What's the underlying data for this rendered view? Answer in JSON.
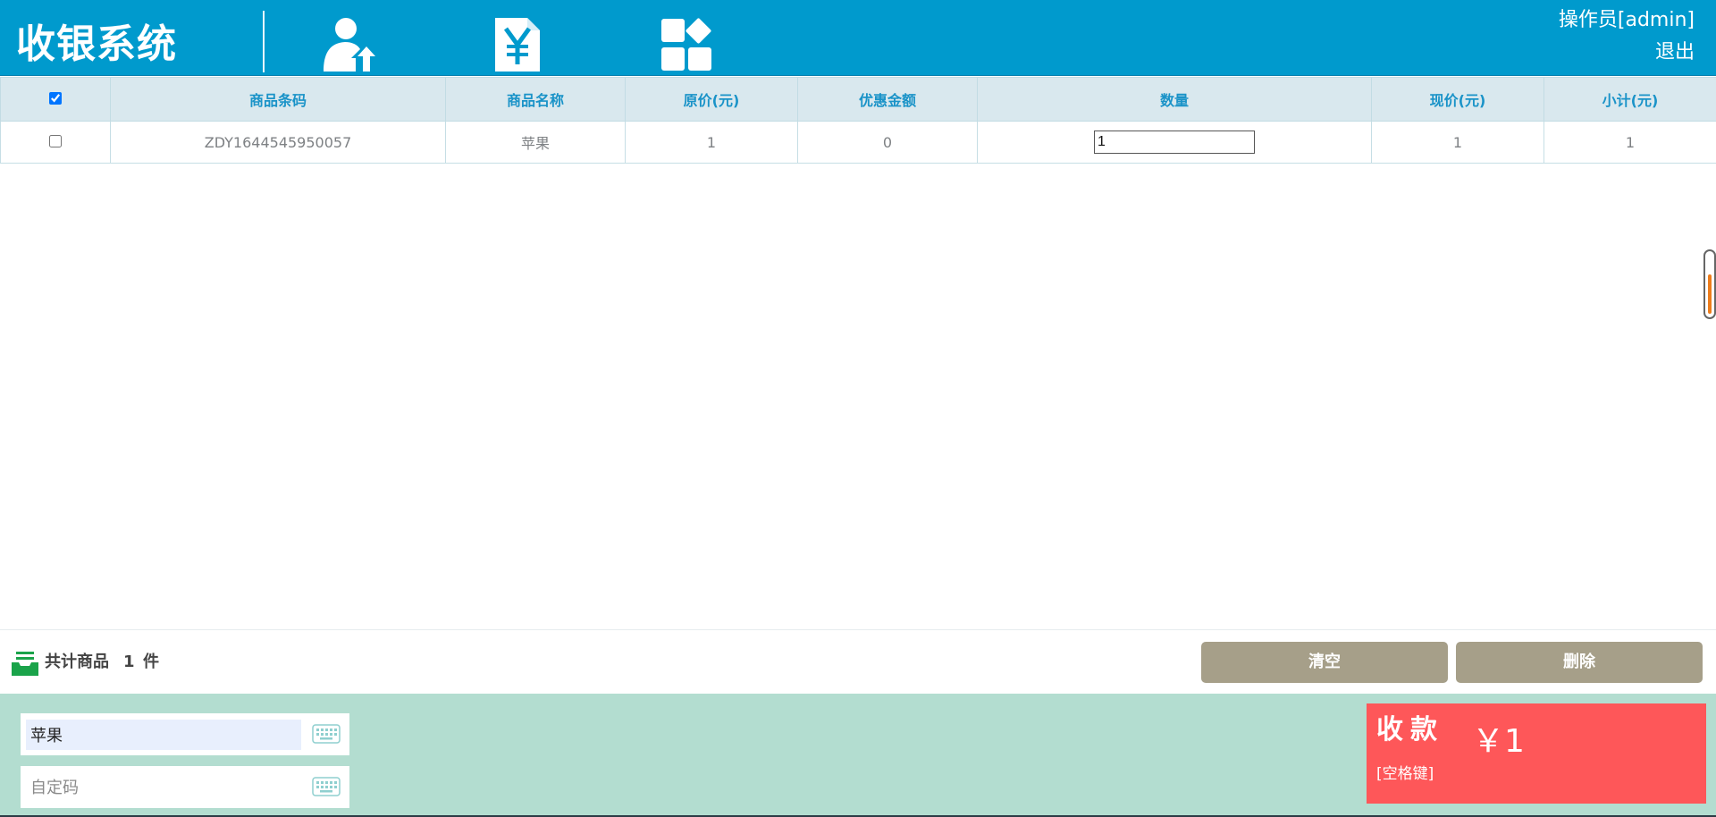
{
  "header": {
    "title": "收银系统",
    "operator": "操作员[admin]",
    "logout": "退出",
    "nav_icons": [
      "user-upload-icon",
      "yen-document-icon",
      "apps-grid-icon"
    ]
  },
  "table": {
    "columns": [
      "商品条码",
      "商品名称",
      "原价(元)",
      "优惠金额",
      "数量",
      "现价(元)",
      "小计(元)"
    ],
    "rows": [
      {
        "barcode": "ZDY1644545950057",
        "name": "苹果",
        "original_price": "1",
        "discount": "0",
        "quantity": "1",
        "current_price": "1",
        "subtotal": "1"
      }
    ]
  },
  "summary": {
    "total_label": "共计商品",
    "total_count": "1",
    "total_unit": "件",
    "clear_label": "清空",
    "delete_label": "删除"
  },
  "input": {
    "search_value": "苹果",
    "custom_code_placeholder": "自定码"
  },
  "pay": {
    "title": "收款",
    "amount": "￥1",
    "hint": "[空格键]"
  },
  "colors": {
    "header_bg": "#009acd",
    "table_header_bg": "#d9e8ee",
    "table_header_text": "#1a93c8",
    "button_gray": "#a69f89",
    "bottom_bg": "#b3ddd0",
    "pay_bg": "#fe5759"
  }
}
